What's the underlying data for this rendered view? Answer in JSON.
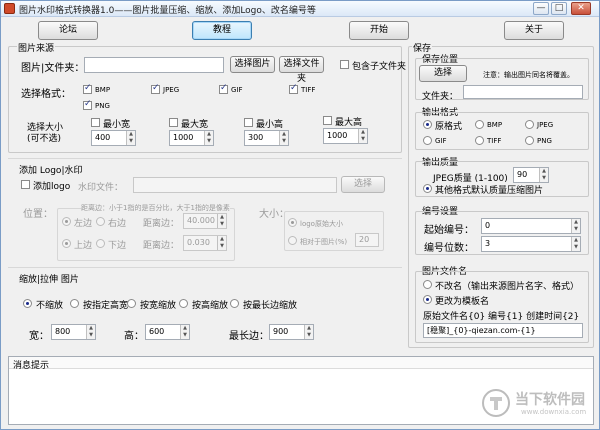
{
  "window": {
    "title": "图片水印格式转换器1.0——图片批量压缩、缩放、添加Logo、改名编号等",
    "controls": {
      "minimize": "—",
      "maximize": "□",
      "close": "✕"
    }
  },
  "toolbar": {
    "forum": "论坛",
    "tutorial": "教程",
    "start": "开始",
    "about": "关于"
  },
  "source": {
    "title": "图片来源",
    "label": "图片|文件夹：",
    "path_value": "",
    "select_image": "选择图片",
    "select_folder": "选择文件夹",
    "include_subfolders": "包含子文件夹",
    "include_subfolders_checked": false,
    "format_label": "选择格式：",
    "formats": [
      {
        "name": "BMP",
        "checked": true
      },
      {
        "name": "JPEG",
        "checked": true
      },
      {
        "name": "GIF",
        "checked": true
      },
      {
        "name": "TIFF",
        "checked": true
      },
      {
        "name": "PNG",
        "checked": true
      }
    ],
    "size_label": "选择大小",
    "size_label2": "(可不选)",
    "sizes": [
      {
        "label": "最小宽",
        "value": "400"
      },
      {
        "label": "最大宽",
        "value": "1000"
      },
      {
        "label": "最小高",
        "value": "300"
      },
      {
        "label": "最大高",
        "value": "1000"
      }
    ]
  },
  "logo": {
    "title": "添加 Logo|水印",
    "add_logo": "添加logo",
    "add_logo_checked": false,
    "file_label": "水印文件：",
    "file_value": "",
    "select": "选择",
    "position_label": "位置：",
    "margin_hint": "距离边：小于1指的是百分比，大于1指的是像素",
    "left": "左边",
    "right": "右边",
    "top": "上边",
    "bottom": "下边",
    "right_margin_label": "距离边：",
    "right_margin_value": "40.000",
    "top_margin_label": "距离边：",
    "top_margin_value": "0.030",
    "size_label": "大小：",
    "original_size": "logo原始大小",
    "relative_size": "相对于图片(%)",
    "relative_value": "20"
  },
  "scale": {
    "title": "缩放|拉伸 图片",
    "options": [
      {
        "label": "不缩放",
        "checked": true
      },
      {
        "label": "按指定高宽",
        "checked": false
      },
      {
        "label": "按宽缩放",
        "checked": false
      },
      {
        "label": "按高缩放",
        "checked": false
      },
      {
        "label": "按最长边缩放",
        "checked": false
      }
    ],
    "width_label": "宽：",
    "width_value": "800",
    "height_label": "高：",
    "height_value": "600",
    "longest_label": "最长边：",
    "longest_value": "900"
  },
  "save": {
    "title": "保存",
    "location_title": "保存位置",
    "select": "选择",
    "note": "注意：输出图片同名将覆盖。",
    "folder_label": "文件夹：",
    "folder_value": "",
    "format_title": "输出格式",
    "formats": [
      {
        "name": "原格式",
        "checked": true
      },
      {
        "name": "BMP",
        "checked": false
      },
      {
        "name": "JPEG",
        "checked": false
      },
      {
        "name": "GIF",
        "checked": false
      },
      {
        "name": "TIFF",
        "checked": false
      },
      {
        "name": "PNG",
        "checked": false
      }
    ],
    "quality_title": "输出质量",
    "jpeg_quality_label": "JPEG质量 (1-100)",
    "jpeg_quality_value": "90",
    "other_quality": "其他格式默认质量压缩图片",
    "numbering_title": "编号设置",
    "start_number_label": "起始编号：",
    "start_number_value": "0",
    "digits_label": "编号位数：",
    "digits_value": "3",
    "filename_title": "图片文件名",
    "no_rename": "不改名（输出来源图片名字、格式）",
    "rename": "更改为模板名",
    "template_hint": "原始文件名{0}  编号{1}  创建时间{2}",
    "template_value": "[稳聚]_{0}-qiezan.com-{1}"
  },
  "messages": {
    "title": "消息提示",
    "content": ""
  },
  "watermark": {
    "main": "当下软件园",
    "sub": "www.downxia.com"
  }
}
